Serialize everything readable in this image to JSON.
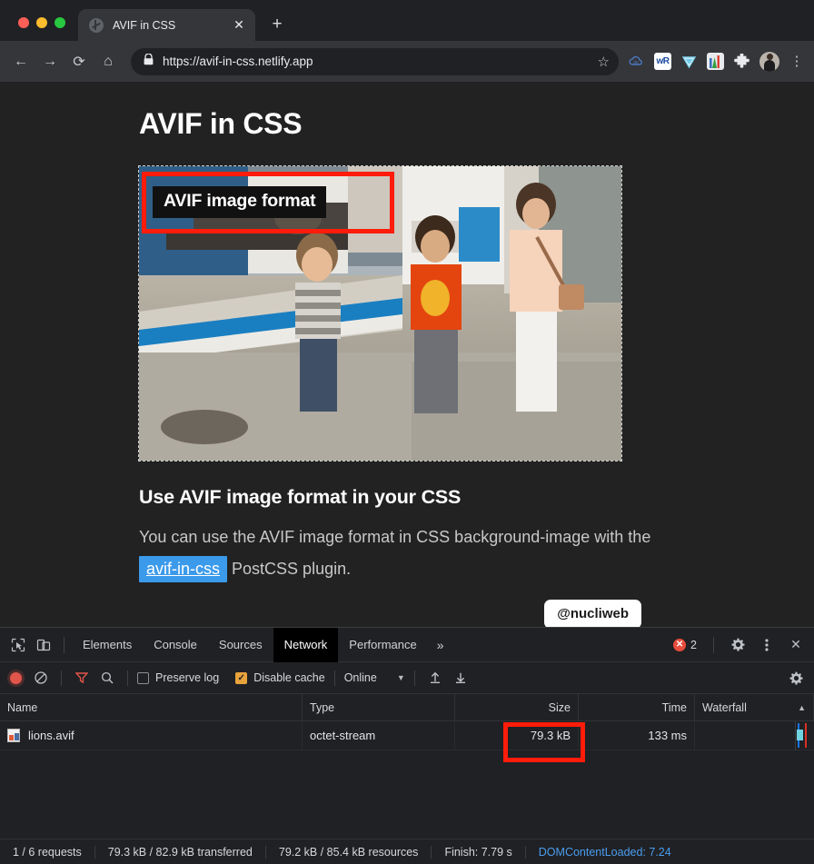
{
  "browser": {
    "tab": {
      "title": "AVIF in CSS",
      "favicon": "globe-icon",
      "close": "✕"
    },
    "new_tab": "+",
    "nav": {
      "back": "←",
      "forward": "→",
      "reload": "⟳",
      "home": "⌂"
    },
    "omnibox": {
      "lock": "lock-icon",
      "url": "https://avif-in-css.netlify.app",
      "bookmark": "☆"
    },
    "extensions": [
      {
        "name": "ithelp-extension-icon",
        "glyph": "◍"
      },
      {
        "name": "wr-extension-icon",
        "glyph": "wR"
      },
      {
        "name": "diamond-extension-icon",
        "glyph": "◆"
      },
      {
        "name": "chart-extension-icon",
        "glyph": "▮"
      },
      {
        "name": "puzzle-extensions-icon",
        "glyph": "✦"
      }
    ],
    "profile_avatar": "avatar",
    "menu": "⋮"
  },
  "page": {
    "title": "AVIF in CSS",
    "hero": {
      "overlay_label": "AVIF image format",
      "annotation": "red-highlight-box"
    },
    "heading": "Use AVIF image format in your CSS",
    "paragraph_part1": "You can use the AVIF image format in CSS background-image",
    "paragraph_part2": "with the",
    "link_text": "avif-in-css",
    "paragraph_part3": "PostCSS plugin.",
    "badge": "@nucliweb"
  },
  "devtools": {
    "inspect_icon": "inspect-element-icon",
    "device_icon": "device-toolbar-icon",
    "tabs": [
      {
        "label": "Elements",
        "active": false
      },
      {
        "label": "Console",
        "active": false
      },
      {
        "label": "Sources",
        "active": false
      },
      {
        "label": "Network",
        "active": true
      },
      {
        "label": "Performance",
        "active": false
      }
    ],
    "more_tabs": "»",
    "errors": {
      "count": "2",
      "glyph": "✕"
    },
    "settings_icon": "gear-icon",
    "kebab_icon": "more-options-icon",
    "close_icon": "✕",
    "toolbar": {
      "record": "record-button",
      "clear": "⊘",
      "filter": "filter-icon",
      "search": "search-icon",
      "preserve_log": {
        "label": "Preserve log",
        "checked": false
      },
      "disable_cache": {
        "label": "Disable cache",
        "checked": true,
        "mark": "✓"
      },
      "throttle": {
        "value": "Online",
        "caret": "▼"
      },
      "import_icon": "import-har-icon",
      "export_icon": "export-har-icon",
      "settings_icon": "network-settings-gear-icon"
    },
    "table": {
      "columns": [
        "Name",
        "Type",
        "Size",
        "Time",
        "Waterfall"
      ],
      "sort_arrow": "▲",
      "rows": [
        {
          "name": "lions.avif",
          "type": "octet-stream",
          "size": "79.3 kB",
          "time": "133 ms",
          "size_annotated": true
        }
      ]
    },
    "status": [
      {
        "text": "1 / 6 requests",
        "link": false
      },
      {
        "text": "79.3 kB / 82.9 kB transferred",
        "link": false
      },
      {
        "text": "79.2 kB / 85.4 kB resources",
        "link": false
      },
      {
        "text": "Finish: 7.79 s",
        "link": false
      },
      {
        "text": "DOMContentLoaded: 7.24",
        "link": true
      }
    ]
  },
  "colors": {
    "annotation_red": "#ff1c0a",
    "link_blue": "#3c9aea",
    "accent_orange": "#e8a33d",
    "status_link": "#4a9df0",
    "error_red": "#e74c3c"
  }
}
